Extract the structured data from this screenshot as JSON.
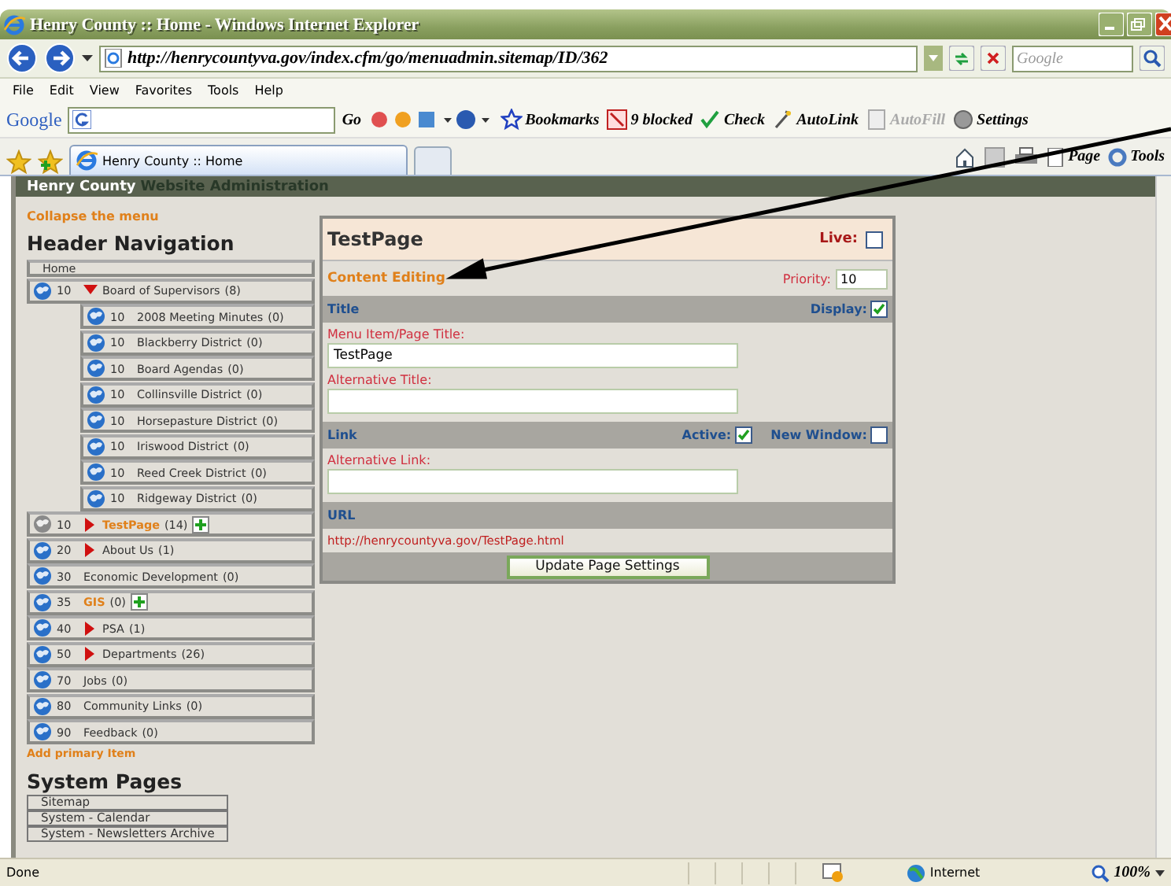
{
  "window": {
    "title": "Henry County :: Home - Windows Internet Explorer"
  },
  "address_bar": {
    "url": "http://henrycountyva.gov/index.cfm/go/menuadmin.sitemap/ID/362",
    "search_placeholder": "Google"
  },
  "menu_bar": [
    "File",
    "Edit",
    "View",
    "Favorites",
    "Tools",
    "Help"
  ],
  "google_toolbar": {
    "logo": "Google",
    "go": "Go",
    "items": [
      {
        "kind": "bookmarks",
        "label": "Bookmarks",
        "disabled": false
      },
      {
        "kind": "blocked",
        "label": "9 blocked",
        "disabled": false
      },
      {
        "kind": "check",
        "label": "Check",
        "disabled": false
      },
      {
        "kind": "autolink",
        "label": "AutoLink",
        "disabled": false
      },
      {
        "kind": "autofill",
        "label": "AutoFill",
        "disabled": true
      },
      {
        "kind": "settings",
        "label": "Settings",
        "disabled": false
      }
    ]
  },
  "tabs": [
    {
      "label": "Henry County :: Home",
      "selected": true
    }
  ],
  "command_bar": [
    "Page",
    "Tools"
  ],
  "site_header": {
    "brand": "Henry County",
    "title": "Website Administration"
  },
  "sidebar": {
    "collapse_link": "Collapse the menu",
    "nav_title": "Header Navigation",
    "items": [
      {
        "kind": "plain",
        "label": "Home"
      },
      {
        "kind": "page",
        "priority": "10",
        "has_children": true,
        "expanded": true,
        "label": "Board of Supervisors",
        "count": "(8)",
        "highlighted": false,
        "live": true,
        "add": false,
        "children": [
          {
            "kind": "page",
            "priority": "10",
            "has_children": false,
            "label": "2008 Meeting Minutes",
            "count": "(0)",
            "highlighted": false,
            "live": true,
            "add": false
          },
          {
            "kind": "page",
            "priority": "10",
            "has_children": false,
            "label": "Blackberry District",
            "count": "(0)",
            "highlighted": false,
            "live": true,
            "add": false
          },
          {
            "kind": "page",
            "priority": "10",
            "has_children": false,
            "label": "Board Agendas",
            "count": "(0)",
            "highlighted": false,
            "live": true,
            "add": false
          },
          {
            "kind": "page",
            "priority": "10",
            "has_children": false,
            "label": "Collinsville District",
            "count": "(0)",
            "highlighted": false,
            "live": true,
            "add": false
          },
          {
            "kind": "page",
            "priority": "10",
            "has_children": false,
            "label": "Horsepasture District",
            "count": "(0)",
            "highlighted": false,
            "live": true,
            "add": false
          },
          {
            "kind": "page",
            "priority": "10",
            "has_children": false,
            "label": "Iriswood District",
            "count": "(0)",
            "highlighted": false,
            "live": true,
            "add": false
          },
          {
            "kind": "page",
            "priority": "10",
            "has_children": false,
            "label": "Reed Creek District",
            "count": "(0)",
            "highlighted": false,
            "live": true,
            "add": false
          },
          {
            "kind": "page",
            "priority": "10",
            "has_children": false,
            "label": "Ridgeway District",
            "count": "(0)",
            "highlighted": false,
            "live": true,
            "add": false
          }
        ]
      },
      {
        "kind": "page",
        "priority": "10",
        "has_children": true,
        "expanded": false,
        "label": "TestPage",
        "count": "(14)",
        "highlighted": true,
        "live": false,
        "add": true
      },
      {
        "kind": "page",
        "priority": "20",
        "has_children": true,
        "expanded": false,
        "label": "About Us",
        "count": "(1)",
        "highlighted": false,
        "live": true,
        "add": false
      },
      {
        "kind": "page",
        "priority": "30",
        "has_children": false,
        "label": "Economic Development",
        "count": "(0)",
        "highlighted": false,
        "live": true,
        "add": false
      },
      {
        "kind": "page",
        "priority": "35",
        "has_children": false,
        "label": "GIS",
        "count": "(0)",
        "highlighted": true,
        "live": true,
        "add": true
      },
      {
        "kind": "page",
        "priority": "40",
        "has_children": true,
        "expanded": false,
        "label": "PSA",
        "count": "(1)",
        "highlighted": false,
        "live": true,
        "add": false
      },
      {
        "kind": "page",
        "priority": "50",
        "has_children": true,
        "expanded": false,
        "label": "Departments",
        "count": "(26)",
        "highlighted": false,
        "live": true,
        "add": false
      },
      {
        "kind": "page",
        "priority": "70",
        "has_children": false,
        "label": "Jobs",
        "count": "(0)",
        "highlighted": false,
        "live": true,
        "add": false
      },
      {
        "kind": "page",
        "priority": "80",
        "has_children": false,
        "label": "Community Links",
        "count": "(0)",
        "highlighted": false,
        "live": true,
        "add": false
      },
      {
        "kind": "page",
        "priority": "90",
        "has_children": false,
        "label": "Feedback",
        "count": "(0)",
        "highlighted": false,
        "live": true,
        "add": false
      }
    ],
    "add_link": "Add primary Item",
    "system_title": "System Pages",
    "system_items": [
      "Sitemap",
      "System - Calendar",
      "System - Newsletters Archive"
    ]
  },
  "panel": {
    "title": "TestPage",
    "live_label": "Live:",
    "live": false,
    "subtitle": "Content Editing",
    "priority_label": "Priority:",
    "priority": "10",
    "sections": [
      {
        "title": "Title",
        "options": [
          {
            "label": "Display:",
            "checked": true
          }
        ],
        "fields": [
          {
            "label": "Menu Item/Page Title:",
            "value": "TestPage"
          },
          {
            "label": "Alternative Title:"
          }
        ]
      },
      {
        "title": "Link",
        "options": [
          {
            "label": "Active:",
            "checked": true
          },
          {
            "label": "New Window:",
            "checked": false
          }
        ],
        "fields": [
          {
            "label": "Alternative Link:"
          }
        ]
      }
    ],
    "url_title": "URL",
    "url": "http://henrycountyva.gov/TestPage.html",
    "button": "Update Page Settings"
  },
  "status_bar": {
    "text": "Done",
    "zone": "Internet",
    "zoom": "100%"
  }
}
